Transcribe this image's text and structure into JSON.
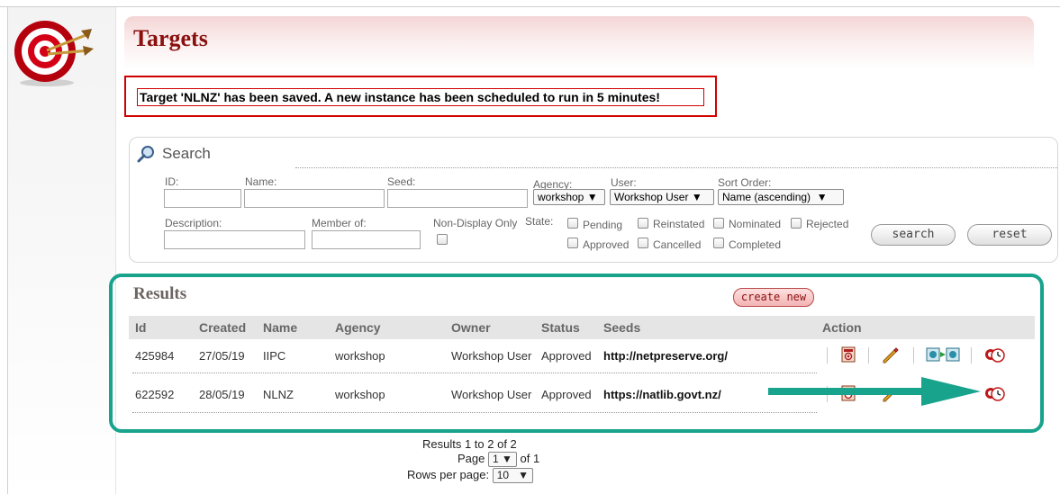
{
  "page": {
    "title": "Targets"
  },
  "message": "Target 'NLNZ' has been saved. A new instance has been scheduled to run in 5 minutes!",
  "search": {
    "title": "Search",
    "labels": {
      "id": "ID:",
      "name": "Name:",
      "seed": "Seed:",
      "agency": "Agency:",
      "user": "User:",
      "sort": "Sort Order:",
      "description": "Description:",
      "member_of": "Member of:",
      "non_display": "Non-Display Only",
      "state": "State:"
    },
    "values": {
      "id": "",
      "name": "",
      "seed": "",
      "description": "",
      "member_of": ""
    },
    "agency_selected": "workshop",
    "user_selected": "Workshop User",
    "sort_selected": "Name (ascending)",
    "states": [
      "Pending",
      "Reinstated",
      "Nominated",
      "Rejected",
      "Approved",
      "Cancelled",
      "Completed"
    ],
    "search_button": "search",
    "reset_button": "reset"
  },
  "results": {
    "title": "Results",
    "create_button": "create new",
    "columns": [
      "Id",
      "Created",
      "Name",
      "Agency",
      "Owner",
      "Status",
      "Seeds",
      "Action"
    ],
    "rows": [
      {
        "id": "425984",
        "created": "27/05/19",
        "name": "IIPC",
        "agency": "workshop",
        "owner": "Workshop User",
        "status": "Approved",
        "seeds": "http://netpreserve.org/"
      },
      {
        "id": "622592",
        "created": "28/05/19",
        "name": "NLNZ",
        "agency": "workshop",
        "owner": "Workshop User",
        "status": "Approved",
        "seeds": "https://natlib.govt.nz/"
      }
    ],
    "action_icons": [
      "view-target-icon",
      "edit-pencil-icon",
      "copy-target-icon",
      "schedule-clock-icon"
    ]
  },
  "pagination": {
    "summary": "Results 1 to 2 of 2",
    "page_label": "Page",
    "page_value": "1",
    "of_label": "of 1",
    "rows_label": "Rows per page:",
    "rows_value": "10"
  },
  "colors": {
    "title": "#8a1010",
    "alert_border": "#d10000",
    "highlight_frame": "#17a38c",
    "arrow": "#17a38c"
  }
}
